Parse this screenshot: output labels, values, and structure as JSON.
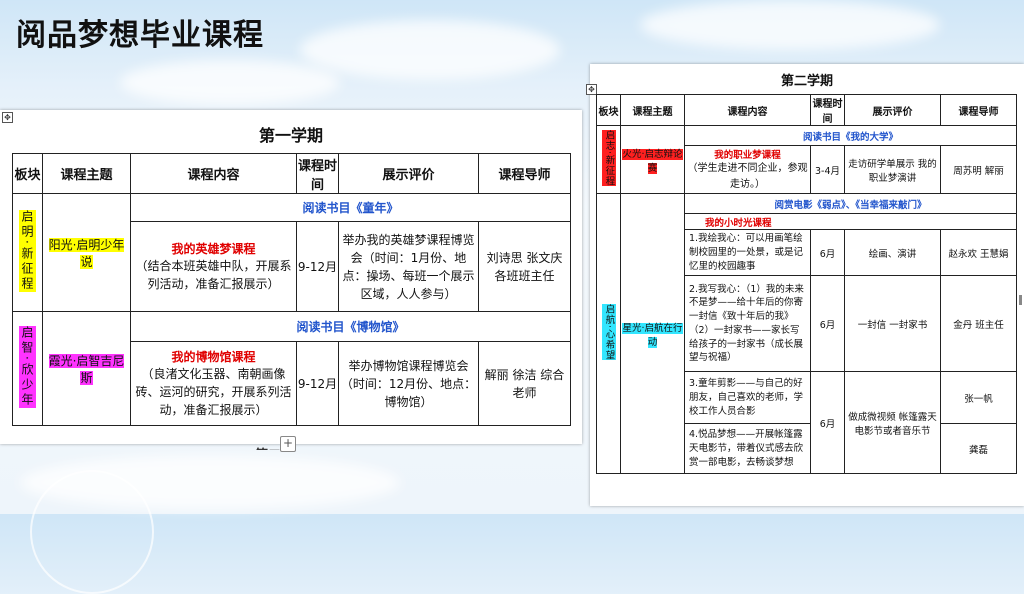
{
  "slide": {
    "title": "阅品梦想毕业课程"
  },
  "headers": [
    "板块",
    "课程主题",
    "课程内容",
    "课程时间",
    "展示评价",
    "课程导师"
  ],
  "semester1": {
    "title": "第一学期",
    "blocks": [
      {
        "section": "启明·新征程",
        "theme": "阳光·启明少年说",
        "reading": "阅读书目《童年》",
        "course_title": "我的英雄梦课程",
        "course_desc": "（结合本班英雄中队，开展系列活动，准备汇报展示）",
        "time": "9-12月",
        "eval": "举办我的英雄梦课程博览会（时间：1月份、地点：操场、每班一个展示区域，人人参与）",
        "tutor": "刘诗思 张文庆 各班班主任"
      },
      {
        "section": "启智·欣少年",
        "theme": "霞光·启智吉尼斯",
        "reading": "阅读书目《博物馆》",
        "course_title": "我的博物馆课程",
        "course_desc": "（良渚文化玉器、南朝画像砖、运河的研究，开展系列活动，准备汇报展示）",
        "time": "9-12月",
        "eval": "举办博物馆课程博览会（时间：12月份、地点：博物馆）",
        "tutor": "解丽 徐洁 综合老师"
      }
    ],
    "cutoff_text": "第二"
  },
  "semester2": {
    "title": "第二学期",
    "header_short": [
      "板块",
      "课程主题",
      "课程内容",
      "课程时间",
      "展示评价",
      "课程导师"
    ],
    "block1": {
      "section": "启志·新征程",
      "theme": "火光·启志辩论赛",
      "reading": "阅读书目《我的大学》",
      "course_title": "我的职业梦课程",
      "course_desc": "（学生走进不同企业，参观走访。）",
      "time": "3-4月",
      "eval": "走访研学单展示 我的职业梦演讲",
      "tutor": "周苏明 解丽"
    },
    "block2": {
      "section": "启航·心希望",
      "theme": "星光·启航在行动",
      "reading": "阅赏电影《弱点》、《当幸福来敲门》",
      "sub_title": "我的小时光课程",
      "rows": [
        {
          "content": "1.我绘我心：可以用画笔绘制校园里的一处景，或是记忆里的校园趣事",
          "time": "6月",
          "eval": "绘画、演讲",
          "tutor": "赵永欢 王慧娟"
        },
        {
          "content": "2.我写我心：（1）我的未来不是梦——给十年后的你寄一封信《致十年后的我》（2）一封家书——家长写给孩子的一封家书（成长展望与祝福）",
          "time": "6月",
          "eval": "一封信 一封家书",
          "tutor": "金丹 班主任"
        },
        {
          "content": "3.童年剪影——与自己的好朋友，自己喜欢的老师，学校工作人员合影",
          "time": "6月",
          "eval": "做成微视频 帐篷露天电影节或者音乐节",
          "tutor": "张一帆"
        },
        {
          "content": "4.悦品梦想——开展帐篷露天电影节，带着仪式感去欣赏一部电影，去畅谈梦想",
          "time": "",
          "eval": "",
          "tutor": "龚磊"
        }
      ]
    }
  },
  "colors": {
    "yellow": "#ffff00",
    "magenta": "#ff33ff",
    "red": "#ff2020",
    "cyan": "#33e6ff",
    "blue_text": "#2255cc"
  },
  "icons": {
    "move": "move-handle-icon",
    "add": "plus-icon"
  }
}
